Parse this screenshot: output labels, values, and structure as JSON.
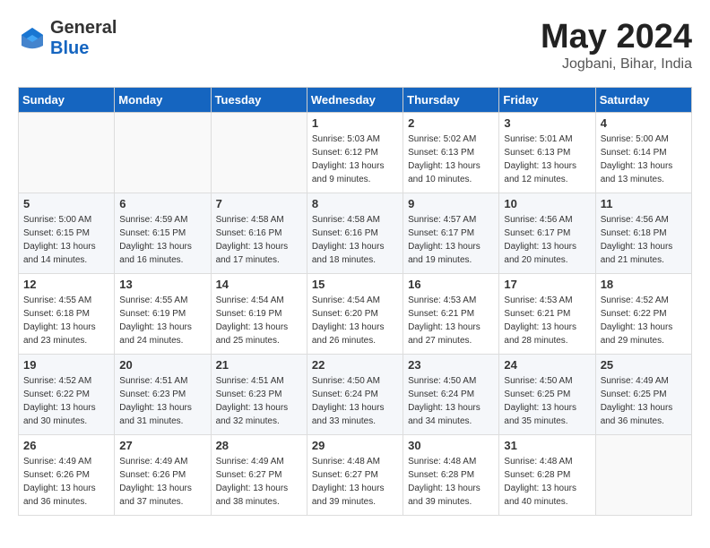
{
  "header": {
    "logo_general": "General",
    "logo_blue": "Blue",
    "month": "May 2024",
    "location": "Jogbani, Bihar, India"
  },
  "days_of_week": [
    "Sunday",
    "Monday",
    "Tuesday",
    "Wednesday",
    "Thursday",
    "Friday",
    "Saturday"
  ],
  "weeks": [
    [
      {
        "day": "",
        "sunrise": "",
        "sunset": "",
        "daylight": ""
      },
      {
        "day": "",
        "sunrise": "",
        "sunset": "",
        "daylight": ""
      },
      {
        "day": "",
        "sunrise": "",
        "sunset": "",
        "daylight": ""
      },
      {
        "day": "1",
        "sunrise": "Sunrise: 5:03 AM",
        "sunset": "Sunset: 6:12 PM",
        "daylight": "Daylight: 13 hours and 9 minutes."
      },
      {
        "day": "2",
        "sunrise": "Sunrise: 5:02 AM",
        "sunset": "Sunset: 6:13 PM",
        "daylight": "Daylight: 13 hours and 10 minutes."
      },
      {
        "day": "3",
        "sunrise": "Sunrise: 5:01 AM",
        "sunset": "Sunset: 6:13 PM",
        "daylight": "Daylight: 13 hours and 12 minutes."
      },
      {
        "day": "4",
        "sunrise": "Sunrise: 5:00 AM",
        "sunset": "Sunset: 6:14 PM",
        "daylight": "Daylight: 13 hours and 13 minutes."
      }
    ],
    [
      {
        "day": "5",
        "sunrise": "Sunrise: 5:00 AM",
        "sunset": "Sunset: 6:15 PM",
        "daylight": "Daylight: 13 hours and 14 minutes."
      },
      {
        "day": "6",
        "sunrise": "Sunrise: 4:59 AM",
        "sunset": "Sunset: 6:15 PM",
        "daylight": "Daylight: 13 hours and 16 minutes."
      },
      {
        "day": "7",
        "sunrise": "Sunrise: 4:58 AM",
        "sunset": "Sunset: 6:16 PM",
        "daylight": "Daylight: 13 hours and 17 minutes."
      },
      {
        "day": "8",
        "sunrise": "Sunrise: 4:58 AM",
        "sunset": "Sunset: 6:16 PM",
        "daylight": "Daylight: 13 hours and 18 minutes."
      },
      {
        "day": "9",
        "sunrise": "Sunrise: 4:57 AM",
        "sunset": "Sunset: 6:17 PM",
        "daylight": "Daylight: 13 hours and 19 minutes."
      },
      {
        "day": "10",
        "sunrise": "Sunrise: 4:56 AM",
        "sunset": "Sunset: 6:17 PM",
        "daylight": "Daylight: 13 hours and 20 minutes."
      },
      {
        "day": "11",
        "sunrise": "Sunrise: 4:56 AM",
        "sunset": "Sunset: 6:18 PM",
        "daylight": "Daylight: 13 hours and 21 minutes."
      }
    ],
    [
      {
        "day": "12",
        "sunrise": "Sunrise: 4:55 AM",
        "sunset": "Sunset: 6:18 PM",
        "daylight": "Daylight: 13 hours and 23 minutes."
      },
      {
        "day": "13",
        "sunrise": "Sunrise: 4:55 AM",
        "sunset": "Sunset: 6:19 PM",
        "daylight": "Daylight: 13 hours and 24 minutes."
      },
      {
        "day": "14",
        "sunrise": "Sunrise: 4:54 AM",
        "sunset": "Sunset: 6:19 PM",
        "daylight": "Daylight: 13 hours and 25 minutes."
      },
      {
        "day": "15",
        "sunrise": "Sunrise: 4:54 AM",
        "sunset": "Sunset: 6:20 PM",
        "daylight": "Daylight: 13 hours and 26 minutes."
      },
      {
        "day": "16",
        "sunrise": "Sunrise: 4:53 AM",
        "sunset": "Sunset: 6:21 PM",
        "daylight": "Daylight: 13 hours and 27 minutes."
      },
      {
        "day": "17",
        "sunrise": "Sunrise: 4:53 AM",
        "sunset": "Sunset: 6:21 PM",
        "daylight": "Daylight: 13 hours and 28 minutes."
      },
      {
        "day": "18",
        "sunrise": "Sunrise: 4:52 AM",
        "sunset": "Sunset: 6:22 PM",
        "daylight": "Daylight: 13 hours and 29 minutes."
      }
    ],
    [
      {
        "day": "19",
        "sunrise": "Sunrise: 4:52 AM",
        "sunset": "Sunset: 6:22 PM",
        "daylight": "Daylight: 13 hours and 30 minutes."
      },
      {
        "day": "20",
        "sunrise": "Sunrise: 4:51 AM",
        "sunset": "Sunset: 6:23 PM",
        "daylight": "Daylight: 13 hours and 31 minutes."
      },
      {
        "day": "21",
        "sunrise": "Sunrise: 4:51 AM",
        "sunset": "Sunset: 6:23 PM",
        "daylight": "Daylight: 13 hours and 32 minutes."
      },
      {
        "day": "22",
        "sunrise": "Sunrise: 4:50 AM",
        "sunset": "Sunset: 6:24 PM",
        "daylight": "Daylight: 13 hours and 33 minutes."
      },
      {
        "day": "23",
        "sunrise": "Sunrise: 4:50 AM",
        "sunset": "Sunset: 6:24 PM",
        "daylight": "Daylight: 13 hours and 34 minutes."
      },
      {
        "day": "24",
        "sunrise": "Sunrise: 4:50 AM",
        "sunset": "Sunset: 6:25 PM",
        "daylight": "Daylight: 13 hours and 35 minutes."
      },
      {
        "day": "25",
        "sunrise": "Sunrise: 4:49 AM",
        "sunset": "Sunset: 6:25 PM",
        "daylight": "Daylight: 13 hours and 36 minutes."
      }
    ],
    [
      {
        "day": "26",
        "sunrise": "Sunrise: 4:49 AM",
        "sunset": "Sunset: 6:26 PM",
        "daylight": "Daylight: 13 hours and 36 minutes."
      },
      {
        "day": "27",
        "sunrise": "Sunrise: 4:49 AM",
        "sunset": "Sunset: 6:26 PM",
        "daylight": "Daylight: 13 hours and 37 minutes."
      },
      {
        "day": "28",
        "sunrise": "Sunrise: 4:49 AM",
        "sunset": "Sunset: 6:27 PM",
        "daylight": "Daylight: 13 hours and 38 minutes."
      },
      {
        "day": "29",
        "sunrise": "Sunrise: 4:48 AM",
        "sunset": "Sunset: 6:27 PM",
        "daylight": "Daylight: 13 hours and 39 minutes."
      },
      {
        "day": "30",
        "sunrise": "Sunrise: 4:48 AM",
        "sunset": "Sunset: 6:28 PM",
        "daylight": "Daylight: 13 hours and 39 minutes."
      },
      {
        "day": "31",
        "sunrise": "Sunrise: 4:48 AM",
        "sunset": "Sunset: 6:28 PM",
        "daylight": "Daylight: 13 hours and 40 minutes."
      },
      {
        "day": "",
        "sunrise": "",
        "sunset": "",
        "daylight": ""
      }
    ]
  ]
}
